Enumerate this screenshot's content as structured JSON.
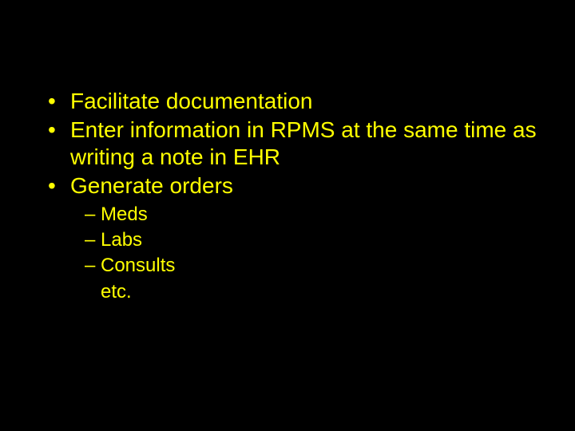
{
  "slide": {
    "bullets": [
      {
        "text": "Facilitate documentation"
      },
      {
        "text": "Enter information in RPMS at the same time as writing a note in EHR"
      },
      {
        "text": "Generate orders",
        "subitems": [
          {
            "text": "Meds"
          },
          {
            "text": "Labs"
          },
          {
            "text": "Consults"
          }
        ],
        "continuation": "etc."
      }
    ]
  },
  "colors": {
    "background": "#000000",
    "text": "#ffff00"
  }
}
